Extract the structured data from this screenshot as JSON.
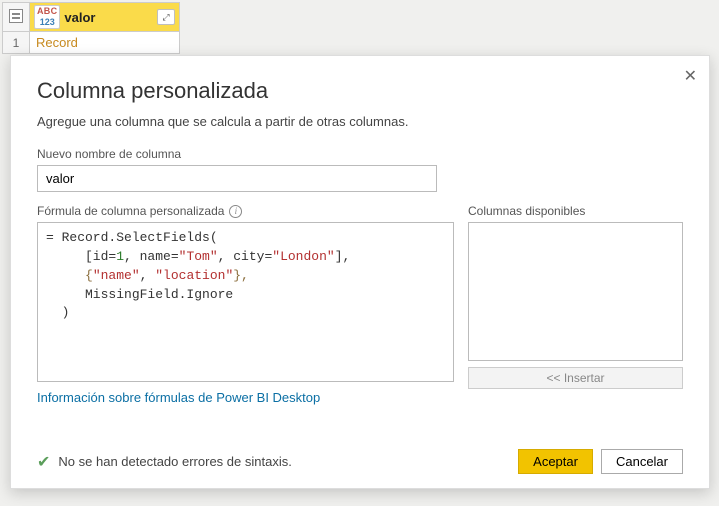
{
  "grid": {
    "column_type_top": "ABC",
    "column_type_bottom": "123",
    "column_name": "valor",
    "row_number": "1",
    "cell_value": "Record"
  },
  "dialog": {
    "title": "Columna personalizada",
    "subtitle": "Agregue una columna que se calcula a partir de otras columnas.",
    "name_label": "Nuevo nombre de columna",
    "name_value": "valor",
    "formula_label": "Fórmula de columna personalizada",
    "avail_label": "Columnas disponibles",
    "insert_label": "<< Insertar",
    "info_link": "Información sobre fórmulas de Power BI Desktop",
    "status": "No se han detectado errores de sintaxis.",
    "accept": "Aceptar",
    "cancel": "Cancelar",
    "formula": {
      "line1_pre": "= Record.SelectFields(",
      "line2_a": "     [id=",
      "line2_num": "1",
      "line2_b": ", name=",
      "line2_str1": "\"Tom\"",
      "line2_c": ", city=",
      "line2_str2": "\"London\"",
      "line2_d": "],",
      "line3_a": "     {",
      "line3_str1": "\"name\"",
      "line3_b": ", ",
      "line3_str2": "\"location\"",
      "line3_c": "},",
      "line4": "     MissingField.Ignore",
      "line5": "  )"
    }
  }
}
